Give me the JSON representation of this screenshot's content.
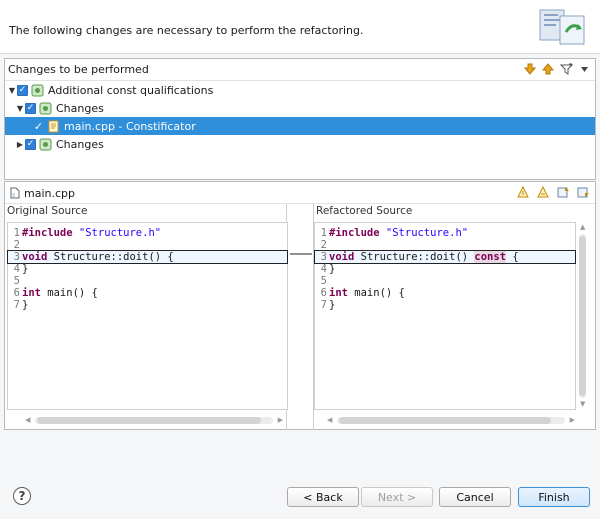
{
  "header": {
    "message": "The following changes are necessary to perform the refactoring."
  },
  "changes": {
    "title": "Changes to be performed",
    "tree": [
      {
        "label": "Additional const qualifications",
        "expanded": true,
        "checked": true,
        "level": 0
      },
      {
        "label": "Changes",
        "expanded": true,
        "checked": true,
        "level": 1
      },
      {
        "label": "main.cpp - Constificator",
        "checked": true,
        "level": 2,
        "selected": true
      },
      {
        "label": "Changes",
        "expanded": false,
        "checked": true,
        "level": 1
      }
    ],
    "tools": [
      "next-change-icon",
      "previous-change-icon",
      "filter-icon",
      "view-menu-icon"
    ]
  },
  "preview": {
    "file": "main.cpp",
    "original_title": "Original Source",
    "refactored_title": "Refactored Source",
    "original_lines": [
      {
        "n": "1",
        "parts": [
          {
            "t": "#include ",
            "c": "kw"
          },
          {
            "t": "\"Structure.h\"",
            "c": "str"
          }
        ]
      },
      {
        "n": "2",
        "parts": []
      },
      {
        "n": "3",
        "parts": [
          {
            "t": "void",
            "c": "kw"
          },
          {
            "t": " Structure::doit() {",
            "c": ""
          }
        ]
      },
      {
        "n": "4",
        "parts": [
          {
            "t": "}",
            "c": ""
          }
        ]
      },
      {
        "n": "5",
        "parts": []
      },
      {
        "n": "6",
        "parts": [
          {
            "t": "int",
            "c": "kw"
          },
          {
            "t": " main() {",
            "c": ""
          }
        ]
      },
      {
        "n": "7",
        "parts": [
          {
            "t": "}",
            "c": ""
          }
        ]
      }
    ],
    "refactored_lines": [
      {
        "n": "1",
        "parts": [
          {
            "t": "#include ",
            "c": "kw"
          },
          {
            "t": "\"Structure.h\"",
            "c": "str"
          }
        ]
      },
      {
        "n": "2",
        "parts": []
      },
      {
        "n": "3",
        "parts": [
          {
            "t": "void",
            "c": "kw"
          },
          {
            "t": " Structure::doit() ",
            "c": ""
          },
          {
            "t": "const",
            "c": "kw hl-change"
          },
          {
            "t": " {",
            "c": ""
          }
        ]
      },
      {
        "n": "4",
        "parts": [
          {
            "t": "}",
            "c": ""
          }
        ]
      },
      {
        "n": "5",
        "parts": []
      },
      {
        "n": "6",
        "parts": [
          {
            "t": "int",
            "c": "kw"
          },
          {
            "t": " main() {",
            "c": ""
          }
        ]
      },
      {
        "n": "7",
        "parts": [
          {
            "t": "}",
            "c": ""
          }
        ]
      }
    ]
  },
  "buttons": {
    "back": "< Back",
    "next": "Next >",
    "cancel": "Cancel",
    "finish": "Finish",
    "help": "?"
  },
  "colors": {
    "selection": "#2f8fda",
    "keyword": "#7f0055",
    "string": "#2a00ff",
    "default_button": "#3e8fd6"
  }
}
